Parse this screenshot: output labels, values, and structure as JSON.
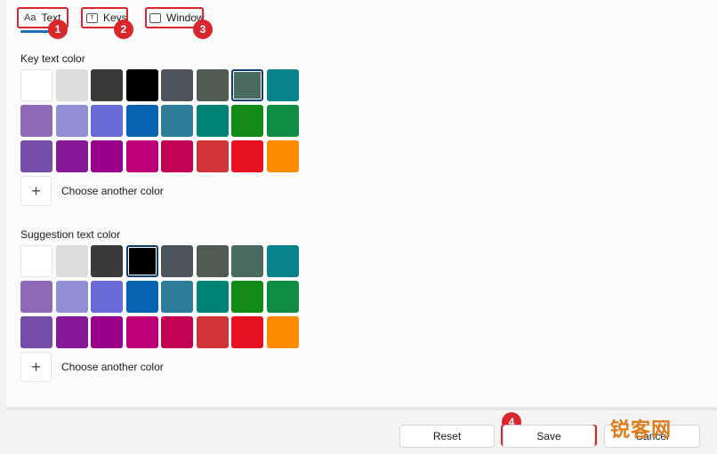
{
  "tabs": [
    {
      "label": "Text",
      "icon": "Aa"
    },
    {
      "label": "Keys",
      "icon": "T"
    },
    {
      "label": "Window",
      "icon": ""
    }
  ],
  "annotations": [
    "1",
    "2",
    "3",
    "4"
  ],
  "sections": {
    "key_text": {
      "title": "Key text color",
      "selected_index": 6
    },
    "suggestion_text": {
      "title": "Suggestion text color",
      "selected_index": 3
    }
  },
  "colors": [
    "#ffffff",
    "#dcdcdc",
    "#3a3a3a",
    "#000000",
    "#4e545c",
    "#505b54",
    "#4a6b62",
    "#08838a",
    "#8e69b8",
    "#8f8fd6",
    "#6a6ad6",
    "#0563b2",
    "#2d7d9a",
    "#008473",
    "#118a18",
    "#0f8c44",
    "#744da9",
    "#881798",
    "#9a0089",
    "#bf0077",
    "#c30052",
    "#d13438",
    "#e81123",
    "#ff8c00"
  ],
  "choose_another_color": "Choose another color",
  "buttons": {
    "reset": "Reset",
    "save": "Save",
    "cancel": "Cancel"
  },
  "watermark": "锐客网",
  "accent_color": "#1a6fc0",
  "callout_color": "#d9262c"
}
